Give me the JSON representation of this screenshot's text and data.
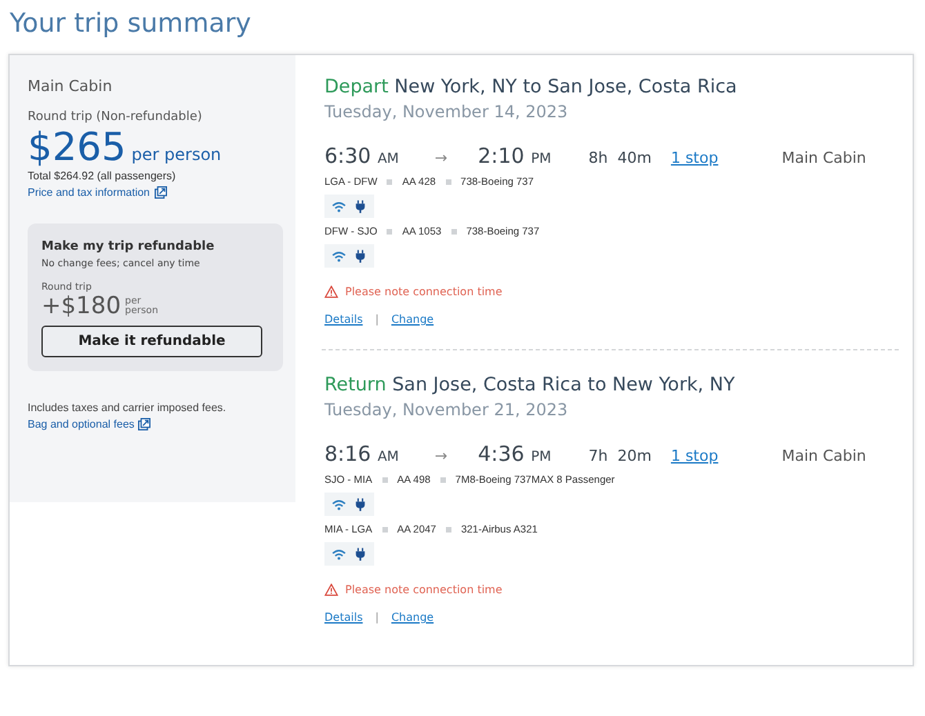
{
  "page_title": "Your trip summary",
  "summary": {
    "cabin": "Main Cabin",
    "fare_type": "Round trip (Non-refundable)",
    "price": "$265",
    "price_unit": "per person",
    "total": "Total $264.92 (all passengers)",
    "price_link": "Price and tax information",
    "refund_offer": {
      "title": "Make my trip refundable",
      "subtitle": "No change fees; cancel any time",
      "trip_type": "Round trip",
      "price": "+$180",
      "price_unit": "per person",
      "button": "Make it refundable"
    },
    "fees_note": "Includes taxes and carrier imposed fees.",
    "fees_link": "Bag and optional fees"
  },
  "flights": [
    {
      "direction": "Depart",
      "route": "New York, NY to San Jose, Costa Rica",
      "date": "Tuesday, November 14, 2023",
      "depart_time": "6:30",
      "depart_period": "AM",
      "arrow": "→",
      "arrive_time": "2:10",
      "arrive_period": "PM",
      "duration": "8h  40m",
      "stops": "1 stop",
      "cabin": "Main Cabin",
      "segments": [
        {
          "route": "LGA - DFW",
          "flight": "AA 428",
          "aircraft": "738-Boeing 737"
        },
        {
          "route": "DFW - SJO",
          "flight": "AA 1053",
          "aircraft": "738-Boeing 737"
        }
      ],
      "warning": "Please note connection time",
      "details_link": "Details",
      "link_separator": "|",
      "change_link": "Change"
    },
    {
      "direction": "Return",
      "route": "San Jose, Costa Rica to New York, NY",
      "date": "Tuesday, November 21, 2023",
      "depart_time": "8:16",
      "depart_period": "AM",
      "arrow": "→",
      "arrive_time": "4:36",
      "arrive_period": "PM",
      "duration": "7h  20m",
      "stops": "1 stop",
      "cabin": "Main Cabin",
      "segments": [
        {
          "route": "SJO - MIA",
          "flight": "AA 498",
          "aircraft": "7M8-Boeing 737MAX 8 Passenger"
        },
        {
          "route": "MIA - LGA",
          "flight": "AA 2047",
          "aircraft": "321-Airbus A321"
        }
      ],
      "warning": "Please note connection time",
      "details_link": "Details",
      "link_separator": "|",
      "change_link": "Change"
    }
  ]
}
